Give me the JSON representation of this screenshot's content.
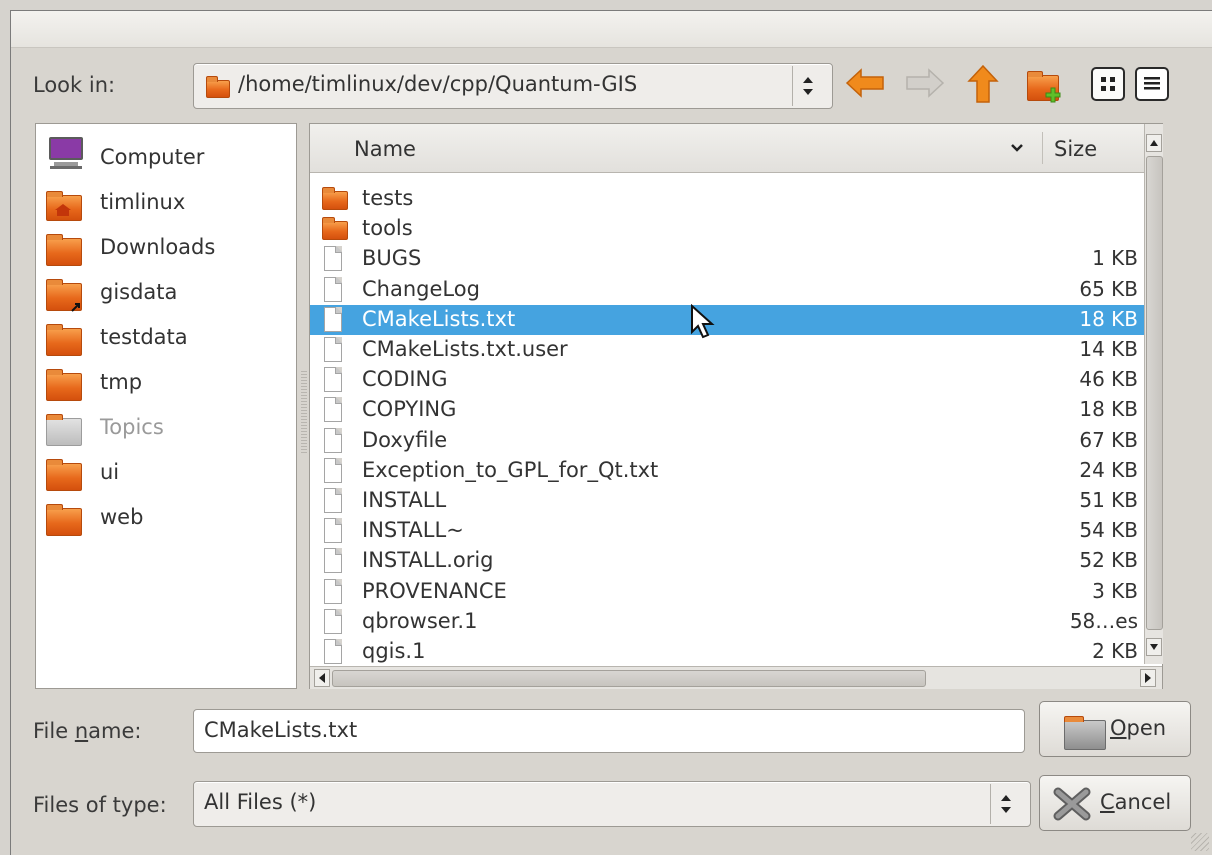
{
  "look_in": {
    "label": "Look in:",
    "path": "/home/timlinux/dev/cpp/Quantum-GIS"
  },
  "toolbar": {
    "back_label": "Back",
    "forward_label": "Forward",
    "up_label": "Parent Directory",
    "new_folder_label": "Create New Folder",
    "list_view_label": "List View",
    "detail_view_label": "Detail View"
  },
  "sidebar": {
    "items": [
      {
        "label": "Computer",
        "icon": "computer-icon"
      },
      {
        "label": "timlinux",
        "icon": "home-folder-icon"
      },
      {
        "label": "Downloads",
        "icon": "folder-icon"
      },
      {
        "label": "gisdata",
        "icon": "folder-link-icon"
      },
      {
        "label": "testdata",
        "icon": "folder-icon"
      },
      {
        "label": "tmp",
        "icon": "folder-icon"
      },
      {
        "label": "Topics",
        "icon": "folder-disabled-icon"
      },
      {
        "label": "ui",
        "icon": "folder-icon"
      },
      {
        "label": "web",
        "icon": "folder-icon"
      }
    ]
  },
  "file_list": {
    "columns": [
      "Name",
      "Size"
    ],
    "rows": [
      {
        "name": "tests",
        "size": "",
        "type": "folder"
      },
      {
        "name": "tools",
        "size": "",
        "type": "folder"
      },
      {
        "name": "BUGS",
        "size": "1 KB",
        "type": "file"
      },
      {
        "name": "ChangeLog",
        "size": "65 KB",
        "type": "file"
      },
      {
        "name": "CMakeLists.txt",
        "size": "18 KB",
        "type": "file",
        "selected": true
      },
      {
        "name": "CMakeLists.txt.user",
        "size": "14 KB",
        "type": "file"
      },
      {
        "name": "CODING",
        "size": "46 KB",
        "type": "file"
      },
      {
        "name": "COPYING",
        "size": "18 KB",
        "type": "file"
      },
      {
        "name": "Doxyfile",
        "size": "67 KB",
        "type": "file"
      },
      {
        "name": "Exception_to_GPL_for_Qt.txt",
        "size": "24 KB",
        "type": "file"
      },
      {
        "name": "INSTALL",
        "size": "51 KB",
        "type": "file"
      },
      {
        "name": "INSTALL~",
        "size": "54 KB",
        "type": "file"
      },
      {
        "name": "INSTALL.orig",
        "size": "52 KB",
        "type": "file"
      },
      {
        "name": "PROVENANCE",
        "size": "3 KB",
        "type": "file"
      },
      {
        "name": "qbrowser.1",
        "size": "58…es",
        "type": "file"
      },
      {
        "name": "qgis.1",
        "size": "2 KB",
        "type": "file"
      }
    ]
  },
  "filename": {
    "label_pre": "File ",
    "label_accel": "n",
    "label_post": "ame:",
    "value": "CMakeLists.txt"
  },
  "filetype": {
    "label": "Files of type:",
    "value": "All Files (*)"
  },
  "buttons": {
    "open_accel": "O",
    "open_rest": "pen",
    "cancel_accel": "C",
    "cancel_rest": "ancel"
  },
  "colors": {
    "selection": "#45a3e0",
    "folder": "#e7681b",
    "arrow_active": "#f08a1c",
    "arrow_disabled": "#bdbab4"
  }
}
